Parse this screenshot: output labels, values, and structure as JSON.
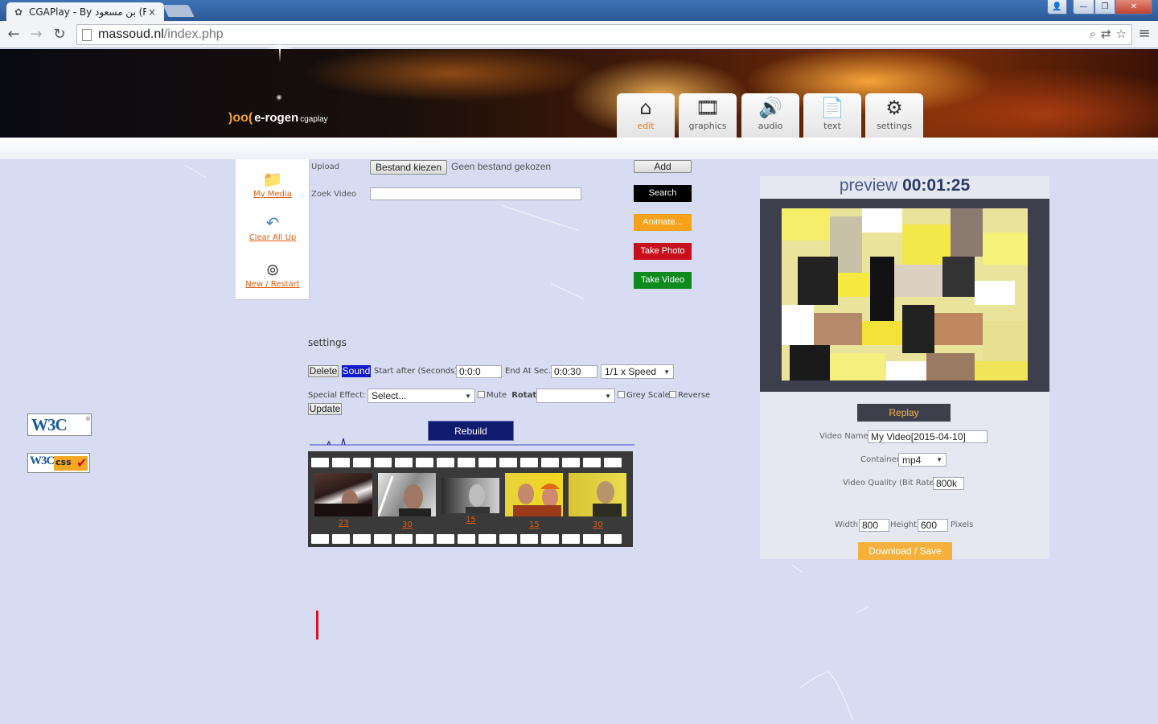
{
  "browser": {
    "tab_title": "CGAPlay - By بن مسعود (R)",
    "tab_close": "×",
    "url_host": "massoud.nl",
    "url_path": "/index.php",
    "window_controls": {
      "user": "👤",
      "minimize": "—",
      "maximize": "❐",
      "close": "✕"
    },
    "nav": {
      "back": "←",
      "forward": "→",
      "reload": "↻",
      "menu": "≡"
    },
    "omni_icons": {
      "zoom": "⌕",
      "translate": "⇄",
      "bookmark": "☆"
    }
  },
  "site": {
    "logo_mark": ")oo(",
    "logo_name": "e-rogen",
    "logo_sub": "cgaplay",
    "nav_tiles": [
      {
        "label": "edit",
        "icon": "home-icon",
        "glyph": "⌂",
        "active": true
      },
      {
        "label": "graphics",
        "icon": "film-icon",
        "glyph": "🎞",
        "active": false
      },
      {
        "label": "audio",
        "icon": "speaker-icon",
        "glyph": "🔊",
        "active": false
      },
      {
        "label": "text",
        "icon": "text-icon",
        "glyph": "📄",
        "active": false
      },
      {
        "label": "settings",
        "icon": "gears-icon",
        "glyph": "⚙",
        "active": false
      }
    ]
  },
  "sidebar": {
    "items": [
      {
        "label": "My Media",
        "icon": "folder-icon",
        "glyph": "📁"
      },
      {
        "label": "Clear All Up",
        "icon": "undo-icon",
        "glyph": "↶"
      },
      {
        "label": "New / Restart",
        "icon": "film-reel-icon",
        "glyph": "⊚"
      }
    ]
  },
  "upload": {
    "label": "Upload",
    "choose_button": "Bestand kiezen",
    "no_file": "Geen bestand gekozen",
    "add_button": "Add"
  },
  "search": {
    "label": "Zoek Video",
    "value": "",
    "button": "Search"
  },
  "actions": {
    "animate": "Animate...",
    "take_photo": "Take Photo",
    "take_video": "Take Video"
  },
  "settings": {
    "title": "settings",
    "delete": "Delete",
    "sound": "Sound",
    "start_after_label": "Start after (Seconds)",
    "start_after_value": "0:0:0",
    "end_at_label": "End At Sec.",
    "end_at_value": "0:0:30",
    "speed_value": "1/1 x Speed",
    "special_effect_label": "Special Effect:",
    "special_effect_value": "Select...",
    "mute_label": "Mute",
    "rotate_label": "Rotate",
    "rotate_value": "",
    "grey_scale_label": "Grey Scale",
    "reverse_label": "Reverse",
    "update": "Update",
    "rebuild": "Rebuild"
  },
  "timeline": {
    "frames": [
      {
        "duration": "23"
      },
      {
        "duration": "30"
      },
      {
        "duration": "15"
      },
      {
        "duration": "15"
      },
      {
        "duration": "30"
      }
    ]
  },
  "preview": {
    "label": "preview",
    "time": "00:01:25",
    "replay": "Replay",
    "video_name_label": "Video Name",
    "video_name_value": "My Video[2015-04-10]",
    "container_label": "Container",
    "container_value": "mp4",
    "quality_label": "Video Quality (Bit Rate)",
    "quality_value": "800k",
    "width_label": "Width",
    "width_value": "800",
    "height_label": "Height",
    "height_value": "600",
    "pixels_label": "Pixels",
    "download": "Download / Save"
  },
  "badges": {
    "w3c": "W3C",
    "w3c_sup": "®",
    "w3c_css_w3c": "W3C",
    "w3c_css_text": "css",
    "w3c_css_check": "✔"
  },
  "colors": {
    "accent_orange": "#f07a12",
    "take_photo": "#c8101c",
    "take_video": "#0f8a1e",
    "animate": "#f7a21b",
    "rebuild": "#101a6e"
  }
}
